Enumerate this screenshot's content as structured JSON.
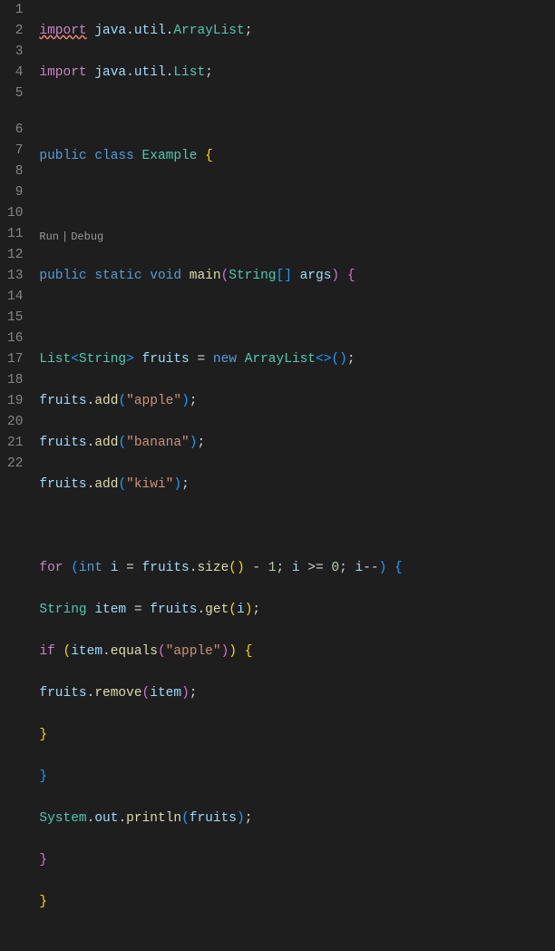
{
  "codelens": {
    "run": "Run",
    "debug": "Debug",
    "sep": "|"
  },
  "code": {
    "kw": {
      "import": "import",
      "public": "public",
      "class": "class",
      "static": "static",
      "void": "void",
      "new": "new",
      "for": "for",
      "int": "int",
      "if": "if"
    },
    "ident": {
      "java": "java",
      "util": "util",
      "ArrayList": "ArrayList",
      "List": "List",
      "Example": "Example",
      "main": "main",
      "String": "String",
      "args": "args",
      "fruits": "fruits",
      "add": "add",
      "size": "size",
      "i": "i",
      "item": "item",
      "get": "get",
      "equals": "equals",
      "remove": "remove",
      "System": "System",
      "out": "out",
      "println": "println"
    },
    "str": {
      "apple": "\"apple\"",
      "banana": "\"banana\"",
      "kiwi": "\"kiwi\""
    },
    "num": {
      "one": "1",
      "zero": "0"
    },
    "punc": {
      "dot": ".",
      "semi": ";",
      "comma": ", ",
      "lbrace": "{",
      "rbrace": "}",
      "lparen": "(",
      "rparen": ")",
      "lt": "<",
      "gt": ">",
      "lbr": "[",
      "rbr": "]",
      "eq": " = ",
      "minus": " - ",
      "gte": " >= ",
      "dec": "--",
      "diamond": "<>"
    }
  },
  "lines": [
    "1",
    "2",
    "3",
    "4",
    "5",
    "6",
    "7",
    "8",
    "9",
    "10",
    "11",
    "12",
    "13",
    "14",
    "15",
    "16",
    "17",
    "18",
    "19",
    "20",
    "21",
    "22"
  ]
}
